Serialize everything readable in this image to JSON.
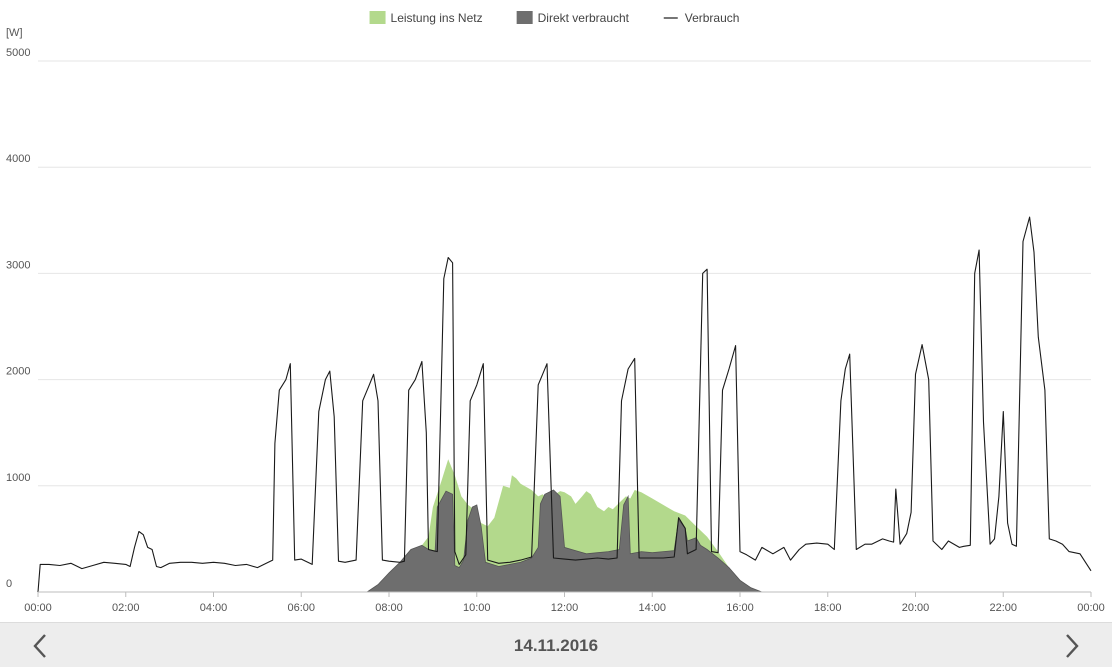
{
  "chart_data": {
    "type": "area",
    "unit_label": "[W]",
    "x_ticks": [
      "00:00",
      "02:00",
      "04:00",
      "06:00",
      "08:00",
      "10:00",
      "12:00",
      "14:00",
      "16:00",
      "18:00",
      "20:00",
      "22:00",
      "00:00"
    ],
    "y_ticks": [
      0,
      1000,
      2000,
      3000,
      4000,
      5000
    ],
    "ylim": [
      0,
      5000
    ],
    "xlim_hours": [
      0,
      24
    ],
    "grid": true,
    "legend_position": "top-center",
    "series": [
      {
        "name": "Leistung ins Netz",
        "kind": "area",
        "color": "#b3d98c",
        "points": [
          [
            7.5,
            0
          ],
          [
            7.75,
            70
          ],
          [
            8,
            180
          ],
          [
            8.25,
            280
          ],
          [
            8.5,
            400
          ],
          [
            8.75,
            440
          ],
          [
            8.9,
            520
          ],
          [
            9,
            800
          ],
          [
            9.2,
            1050
          ],
          [
            9.35,
            1250
          ],
          [
            9.5,
            1100
          ],
          [
            9.65,
            900
          ],
          [
            9.8,
            820
          ],
          [
            10,
            760
          ],
          [
            10.1,
            650
          ],
          [
            10.25,
            620
          ],
          [
            10.4,
            700
          ],
          [
            10.5,
            850
          ],
          [
            10.6,
            1000
          ],
          [
            10.75,
            980
          ],
          [
            10.8,
            1100
          ],
          [
            10.9,
            1070
          ],
          [
            11,
            1020
          ],
          [
            11.25,
            960
          ],
          [
            11.4,
            900
          ],
          [
            11.5,
            920
          ],
          [
            11.6,
            880
          ],
          [
            11.75,
            910
          ],
          [
            11.9,
            950
          ],
          [
            12,
            940
          ],
          [
            12.15,
            900
          ],
          [
            12.25,
            830
          ],
          [
            12.4,
            900
          ],
          [
            12.5,
            950
          ],
          [
            12.6,
            920
          ],
          [
            12.75,
            800
          ],
          [
            12.9,
            760
          ],
          [
            13,
            800
          ],
          [
            13.1,
            780
          ],
          [
            13.25,
            840
          ],
          [
            13.4,
            900
          ],
          [
            13.5,
            880
          ],
          [
            13.6,
            960
          ],
          [
            13.75,
            940
          ],
          [
            14,
            880
          ],
          [
            14.25,
            820
          ],
          [
            14.5,
            760
          ],
          [
            14.75,
            720
          ],
          [
            15,
            620
          ],
          [
            15.25,
            520
          ],
          [
            15.5,
            380
          ],
          [
            15.75,
            230
          ],
          [
            16,
            110
          ],
          [
            16.25,
            40
          ],
          [
            16.5,
            0
          ]
        ]
      },
      {
        "name": "Direkt verbraucht",
        "kind": "area",
        "color": "#6e6e6e",
        "points": [
          [
            7.5,
            0
          ],
          [
            7.75,
            70
          ],
          [
            8,
            180
          ],
          [
            8.25,
            280
          ],
          [
            8.5,
            400
          ],
          [
            8.75,
            440
          ],
          [
            8.9,
            400
          ],
          [
            9.05,
            380
          ],
          [
            9.1,
            800
          ],
          [
            9.3,
            950
          ],
          [
            9.45,
            920
          ],
          [
            9.5,
            250
          ],
          [
            9.6,
            230
          ],
          [
            9.7,
            300
          ],
          [
            9.8,
            680
          ],
          [
            9.9,
            800
          ],
          [
            10,
            820
          ],
          [
            10.1,
            620
          ],
          [
            10.2,
            280
          ],
          [
            10.5,
            240
          ],
          [
            10.75,
            260
          ],
          [
            11,
            280
          ],
          [
            11.25,
            320
          ],
          [
            11.4,
            420
          ],
          [
            11.45,
            830
          ],
          [
            11.55,
            920
          ],
          [
            11.75,
            960
          ],
          [
            11.9,
            900
          ],
          [
            12,
            420
          ],
          [
            12.25,
            390
          ],
          [
            12.5,
            360
          ],
          [
            12.75,
            370
          ],
          [
            13,
            380
          ],
          [
            13.25,
            400
          ],
          [
            13.35,
            820
          ],
          [
            13.45,
            900
          ],
          [
            13.5,
            360
          ],
          [
            13.75,
            380
          ],
          [
            14,
            370
          ],
          [
            14.25,
            380
          ],
          [
            14.5,
            390
          ],
          [
            14.6,
            680
          ],
          [
            14.75,
            600
          ],
          [
            14.8,
            480
          ],
          [
            15,
            510
          ],
          [
            15.1,
            440
          ],
          [
            15.25,
            400
          ],
          [
            15.5,
            320
          ],
          [
            15.75,
            230
          ],
          [
            16,
            110
          ],
          [
            16.25,
            40
          ],
          [
            16.5,
            0
          ]
        ]
      },
      {
        "name": "Verbrauch",
        "kind": "line",
        "color": "#1a1a1a",
        "points": [
          [
            0,
            0
          ],
          [
            0.05,
            260
          ],
          [
            0.25,
            260
          ],
          [
            0.5,
            250
          ],
          [
            0.75,
            270
          ],
          [
            1,
            220
          ],
          [
            1.25,
            250
          ],
          [
            1.5,
            280
          ],
          [
            1.75,
            270
          ],
          [
            2,
            260
          ],
          [
            2.1,
            240
          ],
          [
            2.2,
            420
          ],
          [
            2.3,
            570
          ],
          [
            2.4,
            540
          ],
          [
            2.5,
            420
          ],
          [
            2.6,
            400
          ],
          [
            2.7,
            240
          ],
          [
            2.8,
            230
          ],
          [
            3,
            270
          ],
          [
            3.25,
            280
          ],
          [
            3.5,
            280
          ],
          [
            3.75,
            270
          ],
          [
            4,
            280
          ],
          [
            4.25,
            270
          ],
          [
            4.5,
            250
          ],
          [
            4.75,
            260
          ],
          [
            5,
            230
          ],
          [
            5.25,
            280
          ],
          [
            5.35,
            300
          ],
          [
            5.4,
            1400
          ],
          [
            5.5,
            1900
          ],
          [
            5.65,
            2000
          ],
          [
            5.75,
            2150
          ],
          [
            5.85,
            300
          ],
          [
            6,
            310
          ],
          [
            6.25,
            260
          ],
          [
            6.4,
            1700
          ],
          [
            6.55,
            2000
          ],
          [
            6.65,
            2080
          ],
          [
            6.75,
            1650
          ],
          [
            6.85,
            290
          ],
          [
            7,
            280
          ],
          [
            7.25,
            300
          ],
          [
            7.4,
            1800
          ],
          [
            7.55,
            1950
          ],
          [
            7.65,
            2050
          ],
          [
            7.75,
            1800
          ],
          [
            7.85,
            300
          ],
          [
            8,
            290
          ],
          [
            8.25,
            280
          ],
          [
            8.35,
            290
          ],
          [
            8.45,
            1900
          ],
          [
            8.6,
            2000
          ],
          [
            8.75,
            2170
          ],
          [
            8.85,
            1500
          ],
          [
            8.9,
            400
          ],
          [
            9.1,
            380
          ],
          [
            9.25,
            2950
          ],
          [
            9.35,
            3150
          ],
          [
            9.45,
            3100
          ],
          [
            9.5,
            380
          ],
          [
            9.6,
            260
          ],
          [
            9.75,
            350
          ],
          [
            9.85,
            1800
          ],
          [
            10,
            1950
          ],
          [
            10.15,
            2150
          ],
          [
            10.25,
            300
          ],
          [
            10.5,
            270
          ],
          [
            10.75,
            280
          ],
          [
            11,
            300
          ],
          [
            11.25,
            330
          ],
          [
            11.4,
            1950
          ],
          [
            11.5,
            2050
          ],
          [
            11.6,
            2150
          ],
          [
            11.75,
            320
          ],
          [
            12,
            310
          ],
          [
            12.25,
            300
          ],
          [
            12.5,
            310
          ],
          [
            12.75,
            320
          ],
          [
            13,
            310
          ],
          [
            13.2,
            320
          ],
          [
            13.3,
            1800
          ],
          [
            13.45,
            2100
          ],
          [
            13.6,
            2200
          ],
          [
            13.7,
            320
          ],
          [
            14,
            320
          ],
          [
            14.25,
            320
          ],
          [
            14.5,
            330
          ],
          [
            14.6,
            700
          ],
          [
            14.75,
            600
          ],
          [
            14.8,
            360
          ],
          [
            15,
            400
          ],
          [
            15.15,
            3000
          ],
          [
            15.25,
            3040
          ],
          [
            15.35,
            380
          ],
          [
            15.5,
            370
          ],
          [
            15.6,
            1900
          ],
          [
            15.75,
            2100
          ],
          [
            15.9,
            2320
          ],
          [
            16,
            380
          ],
          [
            16.15,
            350
          ],
          [
            16.35,
            300
          ],
          [
            16.5,
            420
          ],
          [
            16.75,
            360
          ],
          [
            17,
            420
          ],
          [
            17.15,
            300
          ],
          [
            17.35,
            400
          ],
          [
            17.5,
            450
          ],
          [
            17.75,
            460
          ],
          [
            18,
            450
          ],
          [
            18.15,
            400
          ],
          [
            18.3,
            1800
          ],
          [
            18.4,
            2100
          ],
          [
            18.5,
            2240
          ],
          [
            18.65,
            400
          ],
          [
            18.85,
            450
          ],
          [
            19,
            450
          ],
          [
            19.25,
            500
          ],
          [
            19.4,
            480
          ],
          [
            19.5,
            470
          ],
          [
            19.55,
            970
          ],
          [
            19.65,
            450
          ],
          [
            19.8,
            550
          ],
          [
            19.9,
            750
          ],
          [
            20,
            2050
          ],
          [
            20.15,
            2330
          ],
          [
            20.3,
            2000
          ],
          [
            20.4,
            480
          ],
          [
            20.6,
            400
          ],
          [
            20.75,
            480
          ],
          [
            21,
            420
          ],
          [
            21.1,
            430
          ],
          [
            21.25,
            440
          ],
          [
            21.35,
            3000
          ],
          [
            21.45,
            3220
          ],
          [
            21.55,
            1600
          ],
          [
            21.7,
            450
          ],
          [
            21.8,
            500
          ],
          [
            21.9,
            900
          ],
          [
            22,
            1700
          ],
          [
            22.1,
            650
          ],
          [
            22.2,
            450
          ],
          [
            22.3,
            430
          ],
          [
            22.45,
            3300
          ],
          [
            22.6,
            3530
          ],
          [
            22.7,
            3200
          ],
          [
            22.8,
            2400
          ],
          [
            22.95,
            1900
          ],
          [
            23.05,
            500
          ],
          [
            23.2,
            480
          ],
          [
            23.35,
            450
          ],
          [
            23.5,
            380
          ],
          [
            23.75,
            360
          ],
          [
            24,
            200
          ]
        ]
      }
    ]
  },
  "footer": {
    "date": "14.11.2016",
    "prev_icon": "chevron-left-icon",
    "next_icon": "chevron-right-icon"
  }
}
